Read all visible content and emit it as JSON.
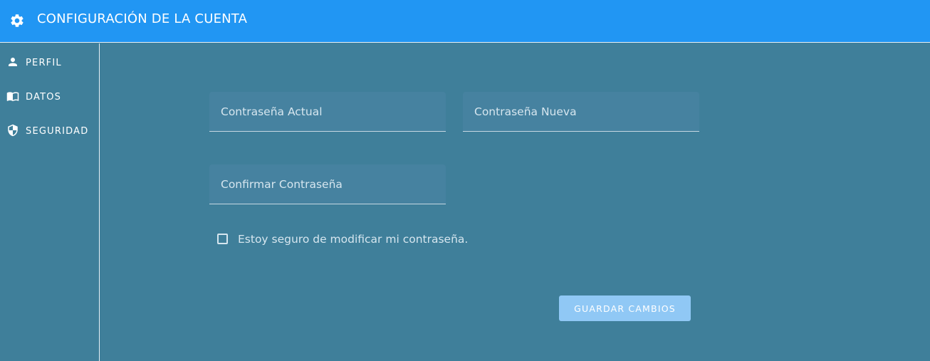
{
  "header": {
    "title": "CONFIGURACIÓN DE LA CUENTA",
    "icon": "gear-icon",
    "color": "#2196f3"
  },
  "sidebar": {
    "items": [
      {
        "label": "PERFIL",
        "icon": "person-icon"
      },
      {
        "label": "DATOS",
        "icon": "book-icon"
      },
      {
        "label": "SEGURIDAD",
        "icon": "shield-icon"
      }
    ]
  },
  "form": {
    "current_password": {
      "placeholder": "Contraseña Actual",
      "value": ""
    },
    "new_password": {
      "placeholder": "Contraseña Nueva",
      "value": ""
    },
    "confirm_password": {
      "placeholder": "Confirmar Contraseña",
      "value": ""
    },
    "confirm_checkbox": {
      "label": "Estoy seguro de modificar mi contraseña.",
      "checked": false
    },
    "save_label": "GUARDAR CAMBIOS"
  },
  "colors": {
    "background": "#3f7f9a",
    "accent": "#2196f3",
    "button_disabled": "#90c8f5"
  }
}
